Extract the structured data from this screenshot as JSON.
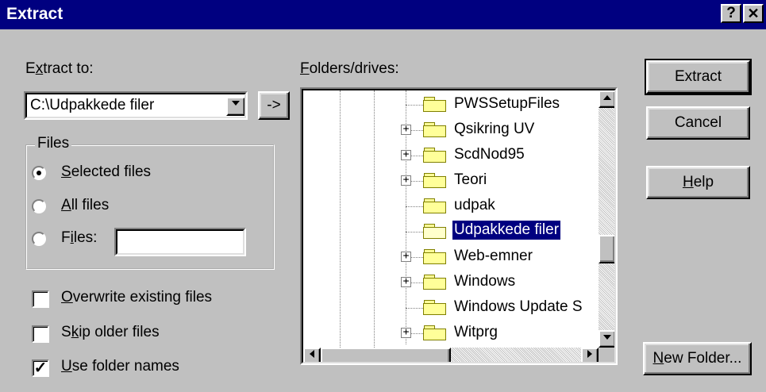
{
  "window": {
    "title": "Extract",
    "help_glyph": "?",
    "close_glyph": "✕"
  },
  "extract_to": {
    "label_prefix": "E",
    "label_underline": "x",
    "label_suffix": "tract to:",
    "value": "C:\\Udpakkede filer",
    "arrow_button": "->"
  },
  "files_group": {
    "legend": "Files",
    "options": [
      {
        "u": "S",
        "rest": "elected files",
        "selected": true
      },
      {
        "u": "A",
        "rest": "ll files",
        "selected": false
      },
      {
        "pre": "F",
        "u": "i",
        "rest": "les:",
        "selected": false
      }
    ],
    "files_input": ""
  },
  "checkboxes": [
    {
      "u": "O",
      "rest": "verwrite existing files",
      "checked": false
    },
    {
      "pre": "S",
      "u": "k",
      "rest": "ip older files",
      "checked": false
    },
    {
      "u": "U",
      "rest": "se folder names",
      "checked": true
    }
  ],
  "folders": {
    "label_u": "F",
    "label_rest": "olders/drives:",
    "items": [
      {
        "name": "PWSSetupFiles",
        "expandable": false,
        "selected": false
      },
      {
        "name": "Qsikring UV",
        "expandable": true,
        "selected": false
      },
      {
        "name": "ScdNod95",
        "expandable": true,
        "selected": false
      },
      {
        "name": "Teori",
        "expandable": true,
        "selected": false
      },
      {
        "name": "udpak",
        "expandable": false,
        "selected": false
      },
      {
        "name": "Udpakkede filer",
        "expandable": false,
        "selected": true
      },
      {
        "name": "Web-emner",
        "expandable": true,
        "selected": false
      },
      {
        "name": "Windows",
        "expandable": true,
        "selected": false
      },
      {
        "name": "Windows Update S",
        "expandable": false,
        "selected": false
      },
      {
        "name": "Witprg",
        "expandable": true,
        "selected": false
      }
    ]
  },
  "buttons": {
    "extract": "Extract",
    "cancel": "Cancel",
    "help_u": "H",
    "help_rest": "elp",
    "new_folder_u": "N",
    "new_folder_rest": "ew Folder..."
  }
}
